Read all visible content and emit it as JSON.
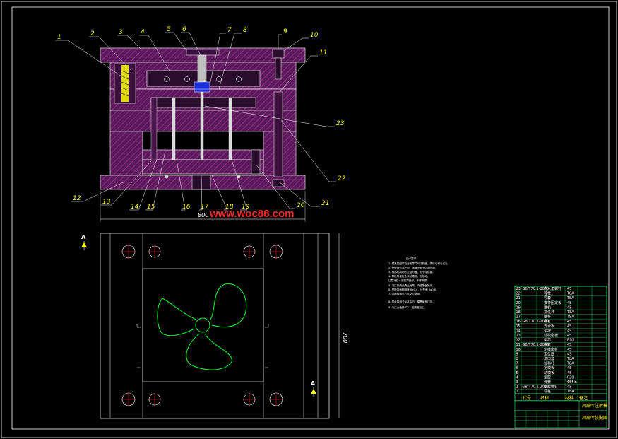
{
  "drawing": {
    "watermark": "www.woc88.com",
    "dimensions": {
      "width": "800",
      "height": "700"
    },
    "section_marks": [
      "A",
      "A"
    ],
    "part_labels": [
      "1",
      "2",
      "3",
      "4",
      "5",
      "6",
      "7",
      "8",
      "9",
      "10",
      "11",
      "23",
      "22",
      "12",
      "13",
      "14",
      "15",
      "16",
      "17",
      "18",
      "19",
      "20",
      "21"
    ],
    "notes": {
      "title": "技术要求",
      "lines": [
        "1. 模具装配前检查各零件尺寸精度，清除毛刺与油污。",
        "2. 分型面贴合严密，间隙不大于0.02mm。",
        "3. 推出机构动作灵活可靠，无卡滞现象。",
        "4. 导柱导套配合滑动顺畅，无松动。",
        "   注意冷却水道密封良好，不得渗漏。",
        "5. 浇注系统光滑无死角，流道表面抛光。",
        "6. 型腔表面粗糙度 Ra0.4，分型面 Ra0.8。",
        "7. 试模合格后方可交付使用。",
        "8. 其余按相关标准执行，模具编号打印。",
        "9. 未注公差按 IT12 级精度加工。"
      ]
    },
    "title_block": {
      "header": [
        "代号",
        "名称",
        "材料",
        "备注"
      ],
      "rows": [
        [
          "23",
          "GB/T70.1-2000",
          "内六角螺钉",
          "45",
          ""
        ],
        [
          "22",
          "",
          "导柱",
          "T8A",
          ""
        ],
        [
          "21",
          "",
          "导套",
          "T8A",
          ""
        ],
        [
          "20",
          "",
          "推杆固定板",
          "45",
          ""
        ],
        [
          "19",
          "",
          "推板",
          "45",
          ""
        ],
        [
          "18",
          "",
          "复位杆",
          "T8A",
          ""
        ],
        [
          "17",
          "",
          "推杆",
          "T8A",
          ""
        ],
        [
          "16",
          "GB/T70.1-2000",
          "螺钉",
          "45",
          ""
        ],
        [
          "15",
          "",
          "支承板",
          "45",
          ""
        ],
        [
          "14",
          "",
          "垫块",
          "45",
          ""
        ],
        [
          "13",
          "",
          "动模座板",
          "45",
          ""
        ],
        [
          "12",
          "",
          "型芯",
          "P20",
          ""
        ],
        [
          "11",
          "GB/T70.1-2000",
          "螺钉",
          "45",
          ""
        ],
        [
          "10",
          "",
          "定模座板",
          "45",
          ""
        ],
        [
          "9",
          "",
          "定位圈",
          "45",
          ""
        ],
        [
          "8",
          "",
          "浇口套",
          "T8A",
          ""
        ],
        [
          "7",
          "",
          "拉料杆",
          "T8A",
          ""
        ],
        [
          "6",
          "",
          "定模板",
          "45",
          ""
        ],
        [
          "5",
          "",
          "动模板",
          "45",
          ""
        ],
        [
          "4",
          "",
          "型腔",
          "P20",
          ""
        ],
        [
          "3",
          "",
          "弹簧",
          "65Mn",
          ""
        ],
        [
          "2",
          "GB/T70.1-2000",
          "限位螺钉",
          "45",
          ""
        ],
        [
          "1",
          "",
          "导柱",
          "T8A",
          ""
        ]
      ],
      "project": "风扇叶注射模",
      "drawing_name": "风扇叶装配图"
    },
    "colors": {
      "background": "#000000",
      "frame": "#ffffff",
      "plate": "#8a2a88",
      "hatch": "#c0409c",
      "label": "#ffff00",
      "leader": "#ffffff",
      "fan": "#00ff33",
      "bolt_mark": "#ff2222",
      "nozzle": "#1a2fd8",
      "title_block": "#19ff66",
      "watermark": "#ff2a2a"
    }
  }
}
